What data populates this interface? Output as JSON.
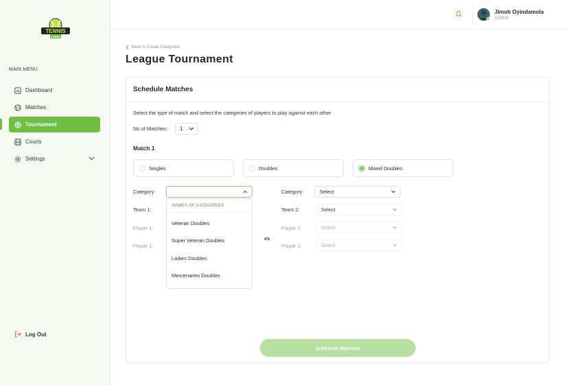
{
  "brand": {
    "logo_text": "TENNIS",
    "logo_subtext": "LOVE",
    "accent": "#6fbf44",
    "accent_soft": "#b6dfa0"
  },
  "sidebar": {
    "section_title": "MAIN MENU",
    "items": [
      {
        "label": "Dashboard",
        "icon": "dashboard-icon",
        "active": false
      },
      {
        "label": "Matches",
        "icon": "tennis-ball-icon",
        "active": false
      },
      {
        "label": "Tournament",
        "icon": "globe-icon",
        "active": true
      },
      {
        "label": "Courts",
        "icon": "court-icon",
        "active": false
      },
      {
        "label": "Settings",
        "icon": "gear-icon",
        "active": false,
        "has_submenu": true
      }
    ],
    "logout_label": "Log Out"
  },
  "header": {
    "user_name": "Jimoh Oyindamola",
    "user_role": "ADMIN"
  },
  "page": {
    "back_label": "Back to Create Categories",
    "title": "League Tournament"
  },
  "card": {
    "title": "Schedule Matches",
    "instructions": "Select the type of match and select the categories of players to play against each other",
    "num_matches_label": "No of Matches:",
    "num_matches_value": "1",
    "match_title": "Match 1",
    "match_types": [
      {
        "label": "Singles",
        "selected": false
      },
      {
        "label": "Doubles",
        "selected": false
      },
      {
        "label": "Mixed Doubles",
        "selected": true
      }
    ],
    "left": {
      "category_label": "Category:",
      "category_value": "",
      "team_label": "Team 1:",
      "player_a_label": "Player 1:",
      "player_b_label": "Player 1:"
    },
    "vs_label": "vs",
    "right": {
      "category_label": "Category:",
      "category_value": "Select",
      "team_label": "Team 2:",
      "team_value": "Select",
      "player_a_label": "Player 2:",
      "player_a_value": "Select",
      "player_b_label": "Player 2:",
      "player_b_value": "Select"
    },
    "dropdown": {
      "header": "NAMES OF CATEGORIES",
      "options": [
        "Veteran Doubles",
        "Super Veteran Doubles",
        "Ladies Doubles",
        "Mercenaries Doubles"
      ]
    },
    "submit_label": "Schedule Matches"
  }
}
